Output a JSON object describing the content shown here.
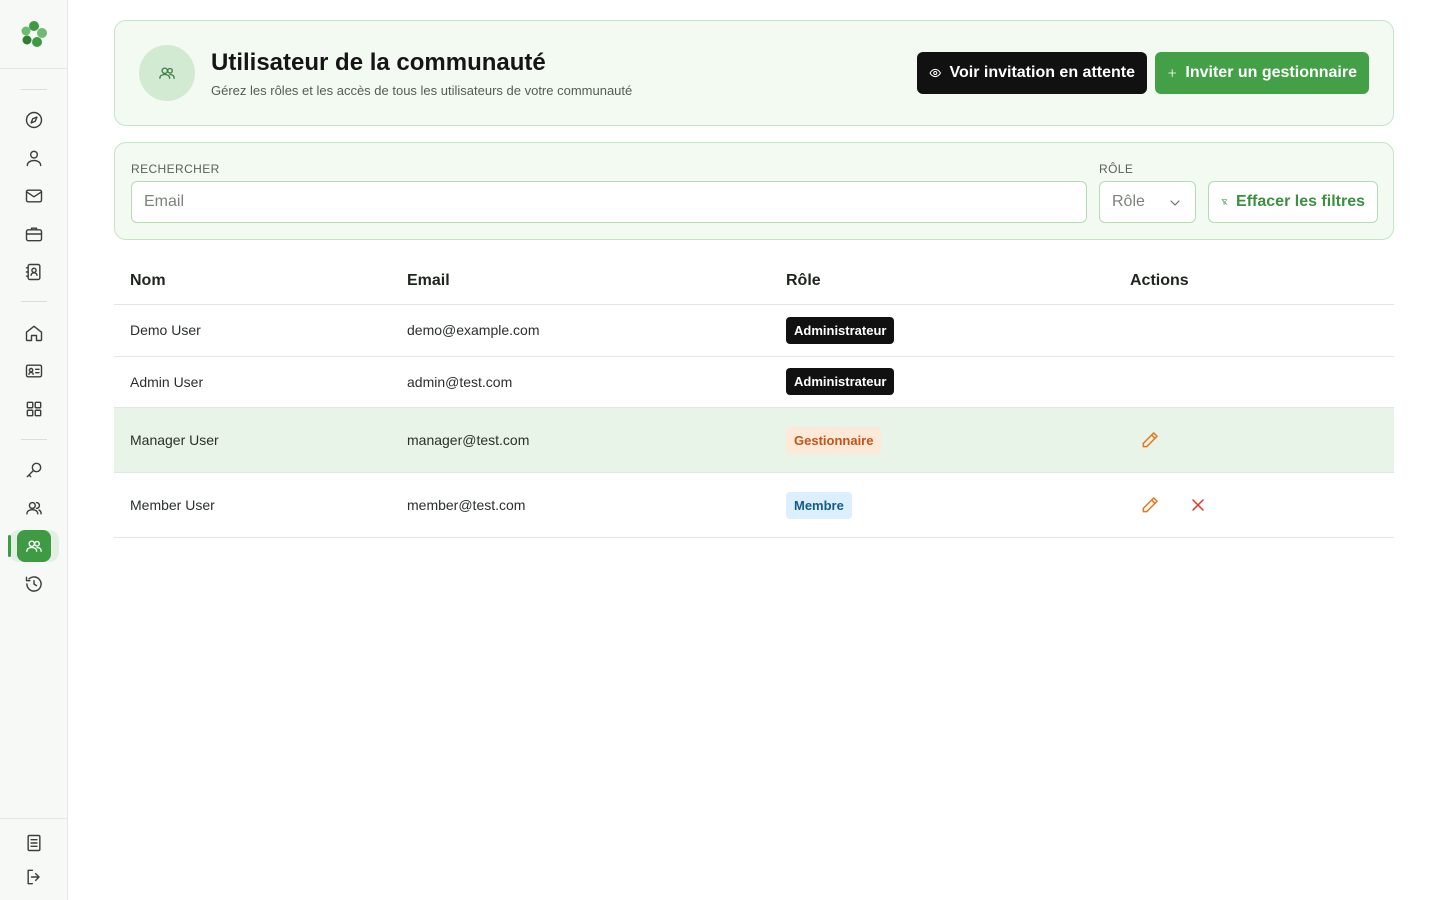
{
  "sidebar": {
    "logo": "clover-logo",
    "nav_icons": [
      "compass-icon",
      "user-icon",
      "mail-icon",
      "briefcase-icon",
      "contact-book-icon",
      "home-icon",
      "id-card-icon",
      "apps-grid-icon",
      "key-icon",
      "users-icon",
      "community-users-icon",
      "history-icon"
    ],
    "active_item": "community-users-icon",
    "bottom_icons": [
      "document-icon",
      "logout-icon"
    ]
  },
  "header": {
    "title": "Utilisateur de la communauté",
    "subtitle": "Gérez les rôles et les accès de tous les utilisateurs de votre communauté",
    "view_pending_label": "Voir invitation en attente",
    "invite_manager_label": "Inviter un gestionnaire"
  },
  "filters": {
    "search_label": "RECHERCHER",
    "search_placeholder": "Email",
    "search_value": "",
    "role_label": "RÔLE",
    "role_placeholder": "Rôle",
    "clear_label": "Effacer les filtres"
  },
  "table": {
    "columns": [
      "Nom",
      "Email",
      "Rôle",
      "Actions"
    ],
    "rows": [
      {
        "name": "Demo User",
        "email": "demo@example.com",
        "role": "Administrateur"
      },
      {
        "name": "Admin User",
        "email": "admin@test.com",
        "role": "Administrateur"
      },
      {
        "name": "Manager User",
        "email": "manager@test.com",
        "role": "Gestionnaire"
      },
      {
        "name": "Member User",
        "email": "member@test.com",
        "role": "Membre"
      }
    ]
  },
  "colors": {
    "brand_green": "#43a047",
    "card_bg": "#f3faf2",
    "card_border": "#c7e3c6",
    "admin_badge": "#111111",
    "manager_badge_text": "#c2541a",
    "member_badge_text": "#145c8a",
    "edit_icon": "#e27a1f",
    "delete_icon": "#e0392f"
  }
}
